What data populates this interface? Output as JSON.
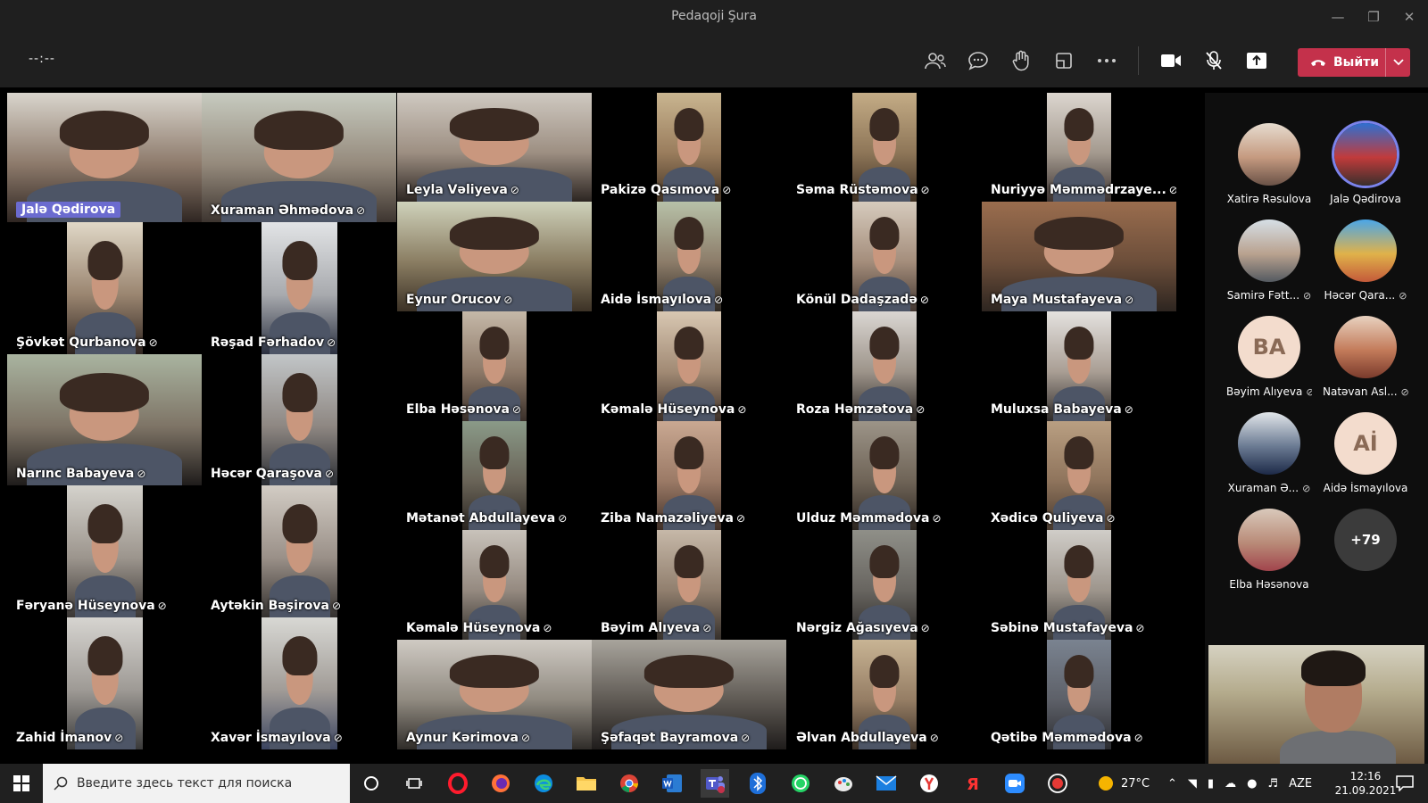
{
  "window": {
    "title": "Pedaqoji Şura"
  },
  "toolbar": {
    "timer": "--:--",
    "leave_label": "Выйти"
  },
  "tiles": [
    {
      "name": "Jalə Qədirova",
      "pill": true
    },
    {
      "name": "Xuraman Əhmədova"
    },
    {
      "name": "Leyla Vəliyeva"
    },
    {
      "name": "Pakizə Qasımova"
    },
    {
      "name": "Səma Rüstəmova"
    },
    {
      "name": "Nuriyyə Məmmədrzaye..."
    },
    {
      "name": "Eynur Orucov"
    },
    {
      "name": "Aidə İsmayılova"
    },
    {
      "name": "Könül Dadaşzadə"
    },
    {
      "name": "Maya Mustafayeva"
    },
    {
      "name": "Şövkət Qurbanova"
    },
    {
      "name": "Rəşad Fərhadov"
    },
    {
      "name": "Elba Həsənova"
    },
    {
      "name": "Kəmalə Hüseynova"
    },
    {
      "name": "Roza Həmzətova"
    },
    {
      "name": "Muluxsa Babayeva"
    },
    {
      "name": "Narınc Babayeva"
    },
    {
      "name": "Həcər Qaraşova"
    },
    {
      "name": "Mətanət Abdullayeva"
    },
    {
      "name": "Ziba Namazəliyeva"
    },
    {
      "name": "Ulduz Məmmədova"
    },
    {
      "name": "Xədicə Quliyeva"
    },
    {
      "name": "Fəryanə Hüseynova"
    },
    {
      "name": "Aytəkin Bəşirova"
    },
    {
      "name": "Kəmalə Hüseynova"
    },
    {
      "name": "Bəyim Alıyeva"
    },
    {
      "name": "Nərgiz Ağasıyeva"
    },
    {
      "name": "Səbinə Mustafayeva"
    },
    {
      "name": "Zahid İmanov"
    },
    {
      "name": "Xavər İsmayılova"
    },
    {
      "name": "Aynur Kərimova"
    },
    {
      "name": "Şəfaqət Bayramova"
    },
    {
      "name": "Əlvan Abdullayeva"
    },
    {
      "name": "Qətibə Məmmədova"
    }
  ],
  "sidebar": [
    {
      "name": "Xatirə Rəsulova",
      "type": "photo"
    },
    {
      "name": "Jalə Qədirova",
      "type": "photo",
      "ring": true
    },
    {
      "name": "Samirə Fətt...",
      "type": "photo",
      "muted": true
    },
    {
      "name": "Həcər Qara...",
      "type": "photo",
      "muted": true
    },
    {
      "name": "Bəyim Alıyeva",
      "type": "initials",
      "initials": "BA",
      "muted": true
    },
    {
      "name": "Natəvan Asl...",
      "type": "photo",
      "muted": true
    },
    {
      "name": "Xuraman Ə...",
      "type": "photo",
      "muted": true
    },
    {
      "name": "Aidə İsmayılova",
      "type": "initials",
      "initials": "Aİ"
    },
    {
      "name": "Elba Həsənova",
      "type": "photo"
    },
    {
      "name": "",
      "type": "more",
      "initials": "+79"
    }
  ],
  "taskbar": {
    "search_placeholder": "Введите здесь текст для поиска",
    "weather": "27°C",
    "language": "AZE",
    "time": "12:16",
    "date": "21.09.2021"
  },
  "colors": {
    "leave": "#c4314b",
    "accent": "#6b6bcf",
    "titlebar": "#1f1f1f"
  }
}
